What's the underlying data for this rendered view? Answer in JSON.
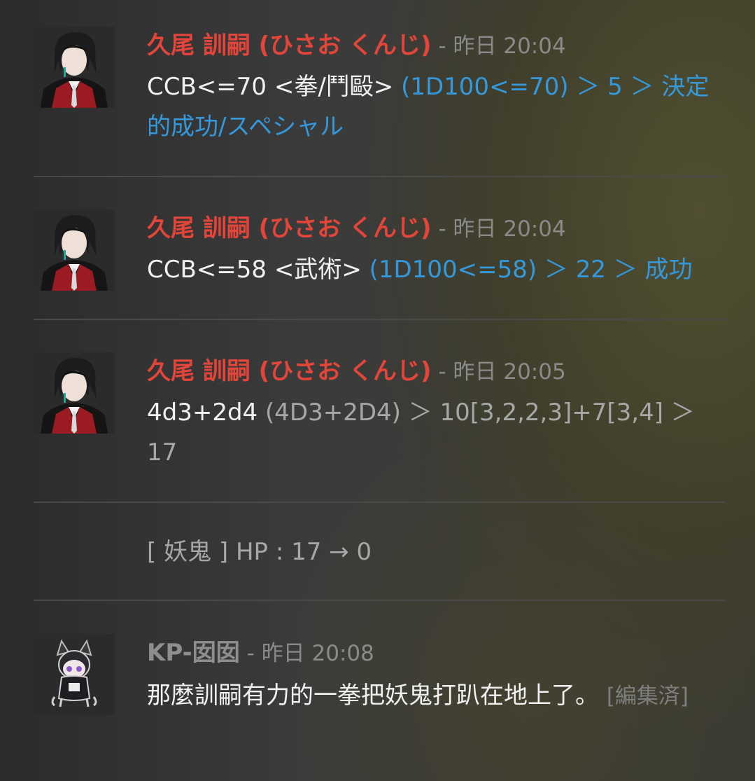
{
  "messages": [
    {
      "author": "久尾 訓嗣 (ひさお くんじ)",
      "separator": " - ",
      "timestamp": "昨日 20:04",
      "command": "CCB<=70 <拳/鬥毆> ",
      "result": "(1D100<=70) ＞ 5 ＞ 決定的成功/スペシャル"
    },
    {
      "author": "久尾 訓嗣 (ひさお くんじ)",
      "separator": " - ",
      "timestamp": "昨日 20:04",
      "command": "CCB<=58 <武術> ",
      "result": "(1D100<=58) ＞ 22 ＞ 成功"
    },
    {
      "author": "久尾 訓嗣 (ひさお くんじ)",
      "separator": " - ",
      "timestamp": "昨日 20:05",
      "command": "4d3+2d4 ",
      "result_gray": "(4D3+2D4)",
      "result_rest": " ＞ 10[3,2,2,3]+7[3,4] ＞ 17"
    },
    {
      "text": "[ 妖鬼 ] HP : 17 → 0"
    },
    {
      "author": "KP-囡囡",
      "separator": " - ",
      "timestamp": "昨日 20:08",
      "text": "那麼訓嗣有力的一拳把妖鬼打趴在地上了。",
      "edited": "[編集済]"
    }
  ],
  "icons": {
    "avatar_1": "character-avatar-icon",
    "avatar_2": "kp-avatar-icon"
  },
  "colors": {
    "author_name": "#e2453a",
    "dice_result": "#3498db",
    "kp_name": "#8e8e8e",
    "timestamp": "#8a8a8a"
  }
}
